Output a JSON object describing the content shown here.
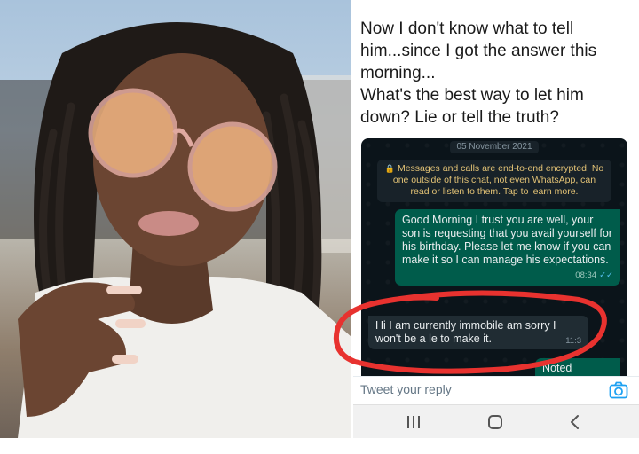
{
  "tweet": {
    "line1": "Now I don't know what to tell",
    "line2": "him...since I got the answer this",
    "line3": "morning...",
    "line4": "What's the best way to let him",
    "line5": "down? Lie or tell the truth?"
  },
  "chat": {
    "date": "05 November 2021",
    "encryption_notice": "Messages and calls are end-to-end encrypted. No one outside of this chat, not even WhatsApp, can read or listen to them. Tap to learn more.",
    "outgoing_message": "Good Morning I trust you are well, your son is requesting that you avail yourself for his birthday. Please let me know if you can make it so I can manage his expectations.",
    "outgoing_time": "08:34",
    "incoming_message": "Hi I am currently immobile am sorry I won't be a le to make it.",
    "incoming_time": "11:3",
    "noted_message": "Noted"
  },
  "reply": {
    "placeholder": "Tweet your reply"
  },
  "icons": {
    "camera": "camera-icon",
    "recents": "recents-icon",
    "home": "home-icon",
    "back": "back-icon",
    "lock": "lock-icon"
  },
  "colors": {
    "wa_background": "#0b141a",
    "wa_outgoing": "#005c4b",
    "wa_incoming": "#202c33",
    "highlight_circle": "#e8322f",
    "twitter_blue": "#1da1f2"
  }
}
